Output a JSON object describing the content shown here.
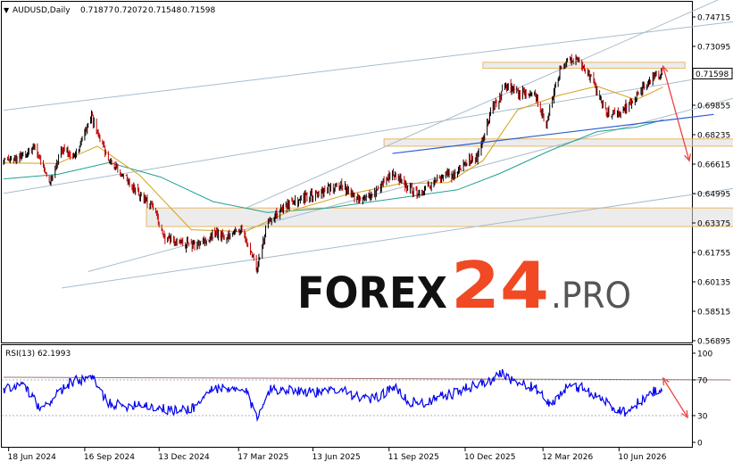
{
  "header": {
    "symbol_label": "AUDUSD,Daily",
    "ohlc": [
      "0.71877",
      "0.72072",
      "0.71548",
      "0.71598"
    ]
  },
  "price_scale": {
    "ticks": [
      "0.74715",
      "0.73095",
      "0.71598",
      "0.69855",
      "0.68235",
      "0.66615",
      "0.64995",
      "0.63375",
      "0.61755",
      "0.60135",
      "0.58515",
      "0.56895"
    ],
    "current_price": "0.71598"
  },
  "rsi_panel": {
    "label": "RSI(13) 62.1993",
    "ticks": [
      "100",
      "70",
      "30",
      "0"
    ]
  },
  "date_axis": {
    "labels": [
      "18 Jun 2024",
      "16 Sep 2024",
      "13 Dec 2024",
      "17 Mar 2025",
      "13 Jun 2025",
      "11 Sep 2025",
      "10 Dec 2025",
      "12 Mar 2026",
      "10 Jun 2026"
    ]
  },
  "watermark": {
    "text_a": "FOREX",
    "text_b": "24",
    "text_c": ".PRO"
  },
  "colors": {
    "bull": "#000000",
    "bear": "#c00000",
    "rsi_line": "#0000ee",
    "ma_fast": "#d4a017",
    "ma_slow": "#20a090",
    "channel": "#a8bccb",
    "trendline_blue": "#2a5fd0",
    "forecast_arrow": "#f04040",
    "zone_fill": "#dcdcdc",
    "zone_border": "#e8b86a",
    "price_tag_bg": "#ffffff"
  },
  "chart_data": [
    {
      "type": "candlestick",
      "title": "AUDUSD,Daily",
      "x_range": [
        "2024-06-12",
        "2026-08-31"
      ],
      "ylim": [
        0.56895,
        0.74715
      ],
      "last_close": 0.71598,
      "series": [
        {
          "values": [
            {
              "x": "2024-06-12",
              "y": 0.6668
            },
            {
              "x": "2024-07-01",
              "y": 0.6695
            },
            {
              "x": "2024-07-20",
              "y": 0.6755
            },
            {
              "x": "2024-08-05",
              "y": 0.6555
            },
            {
              "x": "2024-08-20",
              "y": 0.6745
            },
            {
              "x": "2024-09-05",
              "y": 0.6705
            },
            {
              "x": "2024-09-24",
              "y": 0.6918
            },
            {
              "x": "2024-10-10",
              "y": 0.6725
            },
            {
              "x": "2024-10-28",
              "y": 0.662
            },
            {
              "x": "2024-11-15",
              "y": 0.652
            },
            {
              "x": "2024-12-05",
              "y": 0.642
            },
            {
              "x": "2024-12-20",
              "y": 0.6262
            },
            {
              "x": "2025-01-12",
              "y": 0.6218
            },
            {
              "x": "2025-01-31",
              "y": 0.6225
            },
            {
              "x": "2025-02-15",
              "y": 0.6275
            },
            {
              "x": "2025-03-01",
              "y": 0.6265
            },
            {
              "x": "2025-03-20",
              "y": 0.6305
            },
            {
              "x": "2025-04-08",
              "y": 0.6085
            },
            {
              "x": "2025-04-20",
              "y": 0.6345
            },
            {
              "x": "2025-05-10",
              "y": 0.643
            },
            {
              "x": "2025-06-01",
              "y": 0.647
            },
            {
              "x": "2025-06-25",
              "y": 0.6505
            },
            {
              "x": "2025-07-15",
              "y": 0.6555
            },
            {
              "x": "2025-08-01",
              "y": 0.6475
            },
            {
              "x": "2025-08-25",
              "y": 0.65
            },
            {
              "x": "2025-09-15",
              "y": 0.662
            },
            {
              "x": "2025-10-01",
              "y": 0.654
            },
            {
              "x": "2025-10-20",
              "y": 0.6495
            },
            {
              "x": "2025-11-05",
              "y": 0.6585
            },
            {
              "x": "2025-11-25",
              "y": 0.6605
            },
            {
              "x": "2025-12-10",
              "y": 0.6668
            },
            {
              "x": "2025-12-25",
              "y": 0.6705
            },
            {
              "x": "2026-01-10",
              "y": 0.696
            },
            {
              "x": "2026-01-28",
              "y": 0.7095
            },
            {
              "x": "2026-02-12",
              "y": 0.7045
            },
            {
              "x": "2026-03-01",
              "y": 0.707
            },
            {
              "x": "2026-03-15",
              "y": 0.687
            },
            {
              "x": "2026-04-02",
              "y": 0.7205
            },
            {
              "x": "2026-04-18",
              "y": 0.724
            },
            {
              "x": "2026-05-05",
              "y": 0.7165
            },
            {
              "x": "2026-05-25",
              "y": 0.695
            },
            {
              "x": "2026-06-10",
              "y": 0.693
            },
            {
              "x": "2026-06-28",
              "y": 0.7025
            },
            {
              "x": "2026-07-15",
              "y": 0.712
            },
            {
              "x": "2026-08-01",
              "y": 0.716
            }
          ]
        }
      ],
      "moving_average_fast": [
        {
          "x": "2024-06-12",
          "y": 0.6668
        },
        {
          "x": "2024-08-15",
          "y": 0.6665
        },
        {
          "x": "2024-10-01",
          "y": 0.676
        },
        {
          "x": "2024-11-20",
          "y": 0.66
        },
        {
          "x": "2025-01-20",
          "y": 0.63
        },
        {
          "x": "2025-03-25",
          "y": 0.629
        },
        {
          "x": "2025-05-15",
          "y": 0.64
        },
        {
          "x": "2025-07-20",
          "y": 0.649
        },
        {
          "x": "2025-09-25",
          "y": 0.6555
        },
        {
          "x": "2025-11-20",
          "y": 0.656
        },
        {
          "x": "2025-12-31",
          "y": 0.668
        },
        {
          "x": "2026-02-10",
          "y": 0.696
        },
        {
          "x": "2026-03-31",
          "y": 0.704
        },
        {
          "x": "2026-05-15",
          "y": 0.709
        },
        {
          "x": "2026-06-30",
          "y": 0.7015
        },
        {
          "x": "2026-08-01",
          "y": 0.7085
        }
      ],
      "moving_average_slow": [
        {
          "x": "2024-06-12",
          "y": 0.658
        },
        {
          "x": "2024-08-15",
          "y": 0.6605
        },
        {
          "x": "2024-10-15",
          "y": 0.667
        },
        {
          "x": "2024-12-15",
          "y": 0.659
        },
        {
          "x": "2025-02-15",
          "y": 0.6455
        },
        {
          "x": "2025-04-20",
          "y": 0.6395
        },
        {
          "x": "2025-07-01",
          "y": 0.642
        },
        {
          "x": "2025-09-15",
          "y": 0.647
        },
        {
          "x": "2025-12-01",
          "y": 0.652
        },
        {
          "x": "2026-01-20",
          "y": 0.661
        },
        {
          "x": "2026-03-20",
          "y": 0.6735
        },
        {
          "x": "2026-05-15",
          "y": 0.684
        },
        {
          "x": "2026-07-01",
          "y": 0.6865
        },
        {
          "x": "2026-08-01",
          "y": 0.6905
        }
      ],
      "channel_lines": [
        {
          "from": {
            "x": "2024-06-12",
            "y": 0.6958
          },
          "to": {
            "x": "2026-10-31",
            "y": 0.745
          }
        },
        {
          "from": {
            "x": "2024-06-12",
            "y": 0.65
          },
          "to": {
            "x": "2026-11-20",
            "y": 0.7185
          }
        },
        {
          "from": {
            "x": "2024-08-20",
            "y": 0.598
          },
          "to": {
            "x": "2026-12-31",
            "y": 0.6575
          }
        },
        {
          "from": {
            "x": "2024-09-20",
            "y": 0.607
          },
          "to": {
            "x": "2026-12-31",
            "y": 0.711
          }
        },
        {
          "from": {
            "x": "2025-03-25",
            "y": 0.6418
          },
          "to": {
            "x": "2026-10-05",
            "y": 0.7565
          }
        }
      ],
      "trendline": {
        "from": {
          "x": "2025-09-15",
          "y": 0.672
        },
        "to": {
          "x": "2026-09-30",
          "y": 0.6935
        }
      },
      "zones": [
        {
          "x0": "2025-12-31",
          "x1": "2026-08-27",
          "y0": 0.7189,
          "y1": 0.7222
        },
        {
          "x0": "2025-09-05",
          "x1": "2026-11-28",
          "y0": 0.676,
          "y1": 0.68
        },
        {
          "x0": "2024-11-28",
          "x1": "2026-11-28",
          "y0": 0.6318,
          "y1": 0.642
        }
      ],
      "forecast_arrow": [
        {
          "x": "2026-08-01",
          "y": 0.72
        },
        {
          "x": "2026-09-01",
          "y": 0.668
        }
      ]
    },
    {
      "type": "line",
      "title": "RSI(13) 62.1993",
      "ylim": [
        0,
        100
      ],
      "yticks": [
        100,
        70,
        30,
        0
      ],
      "last_value": 62.1993,
      "series": [
        {
          "values": [
            {
              "x": "2024-06-12",
              "y": 58
            },
            {
              "x": "2024-07-05",
              "y": 65
            },
            {
              "x": "2024-07-28",
              "y": 34
            },
            {
              "x": "2024-08-10",
              "y": 52
            },
            {
              "x": "2024-09-02",
              "y": 68
            },
            {
              "x": "2024-09-25",
              "y": 72
            },
            {
              "x": "2024-10-12",
              "y": 46
            },
            {
              "x": "2024-10-30",
              "y": 40
            },
            {
              "x": "2024-11-20",
              "y": 44
            },
            {
              "x": "2024-12-12",
              "y": 38
            },
            {
              "x": "2025-01-05",
              "y": 35
            },
            {
              "x": "2025-01-25",
              "y": 40
            },
            {
              "x": "2025-02-15",
              "y": 62
            },
            {
              "x": "2025-03-05",
              "y": 58
            },
            {
              "x": "2025-03-25",
              "y": 58
            },
            {
              "x": "2025-04-08",
              "y": 28
            },
            {
              "x": "2025-04-20",
              "y": 58
            },
            {
              "x": "2025-05-10",
              "y": 60
            },
            {
              "x": "2025-06-01",
              "y": 58
            },
            {
              "x": "2025-06-25",
              "y": 55
            },
            {
              "x": "2025-07-15",
              "y": 62
            },
            {
              "x": "2025-08-05",
              "y": 50
            },
            {
              "x": "2025-08-25",
              "y": 48
            },
            {
              "x": "2025-09-15",
              "y": 63
            },
            {
              "x": "2025-10-05",
              "y": 45
            },
            {
              "x": "2025-10-25",
              "y": 44
            },
            {
              "x": "2025-11-15",
              "y": 52
            },
            {
              "x": "2025-12-01",
              "y": 56
            },
            {
              "x": "2025-12-20",
              "y": 64
            },
            {
              "x": "2026-01-10",
              "y": 68
            },
            {
              "x": "2026-01-20",
              "y": 80
            },
            {
              "x": "2026-02-10",
              "y": 66
            },
            {
              "x": "2026-03-01",
              "y": 62
            },
            {
              "x": "2026-03-20",
              "y": 42
            },
            {
              "x": "2026-04-08",
              "y": 60
            },
            {
              "x": "2026-04-25",
              "y": 62
            },
            {
              "x": "2026-05-15",
              "y": 52
            },
            {
              "x": "2026-06-05",
              "y": 38
            },
            {
              "x": "2026-06-20",
              "y": 34
            },
            {
              "x": "2026-07-05",
              "y": 46
            },
            {
              "x": "2026-07-20",
              "y": 56
            },
            {
              "x": "2026-08-01",
              "y": 62
            }
          ]
        }
      ],
      "trendline": {
        "from": {
          "x": "2024-06-12",
          "y": 73
        },
        "to": {
          "x": "2026-10-20",
          "y": 70
        }
      },
      "forecast_arrow": [
        {
          "x": "2026-08-01",
          "y": 72
        },
        {
          "x": "2026-08-30",
          "y": 28
        }
      ]
    }
  ]
}
